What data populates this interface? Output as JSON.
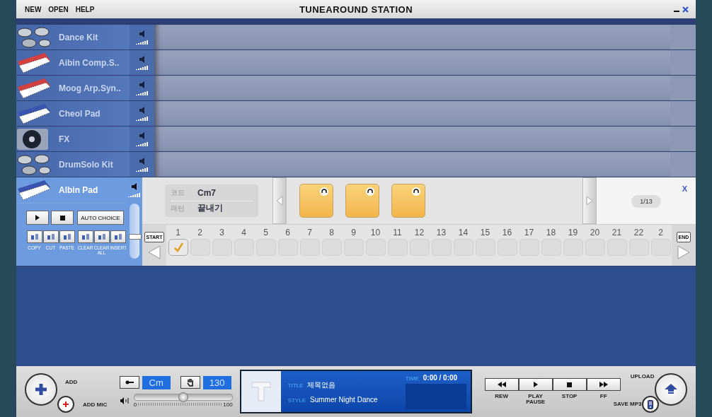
{
  "window": {
    "title": "TUNEAROUND STATION"
  },
  "menu": [
    {
      "label": "NEW"
    },
    {
      "label": "OPEN"
    },
    {
      "label": "HELP"
    }
  ],
  "tracks": [
    {
      "name": "Dance Kit",
      "kind": "drums",
      "selected": false
    },
    {
      "name": "Aibin Comp.S..",
      "kind": "synth",
      "selected": false
    },
    {
      "name": "Moog Arp.Syn..",
      "kind": "synth",
      "selected": false
    },
    {
      "name": "Cheol Pad",
      "kind": "keyboard",
      "selected": false
    },
    {
      "name": "FX",
      "kind": "turntable",
      "selected": false
    },
    {
      "name": "DrumSolo Kit",
      "kind": "drums",
      "selected": false
    },
    {
      "name": "Albin Pad",
      "kind": "keyboard",
      "selected": true
    }
  ],
  "editor": {
    "transport": {
      "auto_choice": "AUTO CHOICE"
    },
    "tools": [
      {
        "label": "COPY"
      },
      {
        "label": "CUT"
      },
      {
        "label": "PASTE"
      },
      {
        "label": "CLEAR"
      },
      {
        "label": "CLEAR ALL"
      },
      {
        "label": "INSERT"
      }
    ],
    "track_volume": {
      "level": 0.4
    },
    "chord": {
      "label": "코드",
      "value": "Cm7"
    },
    "pattern": {
      "label": "패턴",
      "value": "끝내기"
    },
    "pattern_tiles": [
      {
        "selected": false
      },
      {
        "selected": false
      },
      {
        "selected": false
      }
    ],
    "page": "1/13",
    "close": "X",
    "start": "START",
    "end": "END",
    "steps": [
      {
        "label": "1",
        "checked": true
      },
      {
        "label": "2",
        "checked": false
      },
      {
        "label": "3",
        "checked": false
      },
      {
        "label": "4",
        "checked": false
      },
      {
        "label": "5",
        "checked": false
      },
      {
        "label": "6",
        "checked": false
      },
      {
        "label": "7",
        "checked": false
      },
      {
        "label": "8",
        "checked": false
      },
      {
        "label": "9",
        "checked": false
      },
      {
        "label": "10",
        "checked": false
      },
      {
        "label": "11",
        "checked": false
      },
      {
        "label": "12",
        "checked": false
      },
      {
        "label": "13",
        "checked": false
      },
      {
        "label": "14",
        "checked": false
      },
      {
        "label": "15",
        "checked": false
      },
      {
        "label": "16",
        "checked": false
      },
      {
        "label": "17",
        "checked": false
      },
      {
        "label": "18",
        "checked": false
      },
      {
        "label": "19",
        "checked": false
      },
      {
        "label": "20",
        "checked": false
      },
      {
        "label": "21",
        "checked": false
      },
      {
        "label": "22",
        "checked": false
      },
      {
        "label": "2",
        "checked": false
      }
    ]
  },
  "bottom": {
    "add": "ADD",
    "add_mic": "ADD MIC",
    "key": "Cm",
    "tempo": "130",
    "volume": {
      "level": 0.5,
      "min": "0",
      "max": "100"
    },
    "display": {
      "title_label": "TITLE",
      "title": "제목없음",
      "style_label": "STYLE",
      "style": "Summer Night Dance",
      "time_label": "TIME",
      "time": "0:00 / 0:00"
    },
    "transport": [
      {
        "kind": "rew",
        "label": "REW"
      },
      {
        "kind": "play",
        "label": "PLAY\nPAUSE"
      },
      {
        "kind": "stop",
        "label": "STOP"
      },
      {
        "kind": "ff",
        "label": "FF"
      }
    ],
    "upload": "UPLOAD",
    "save_mp3": "SAVE MP3"
  }
}
